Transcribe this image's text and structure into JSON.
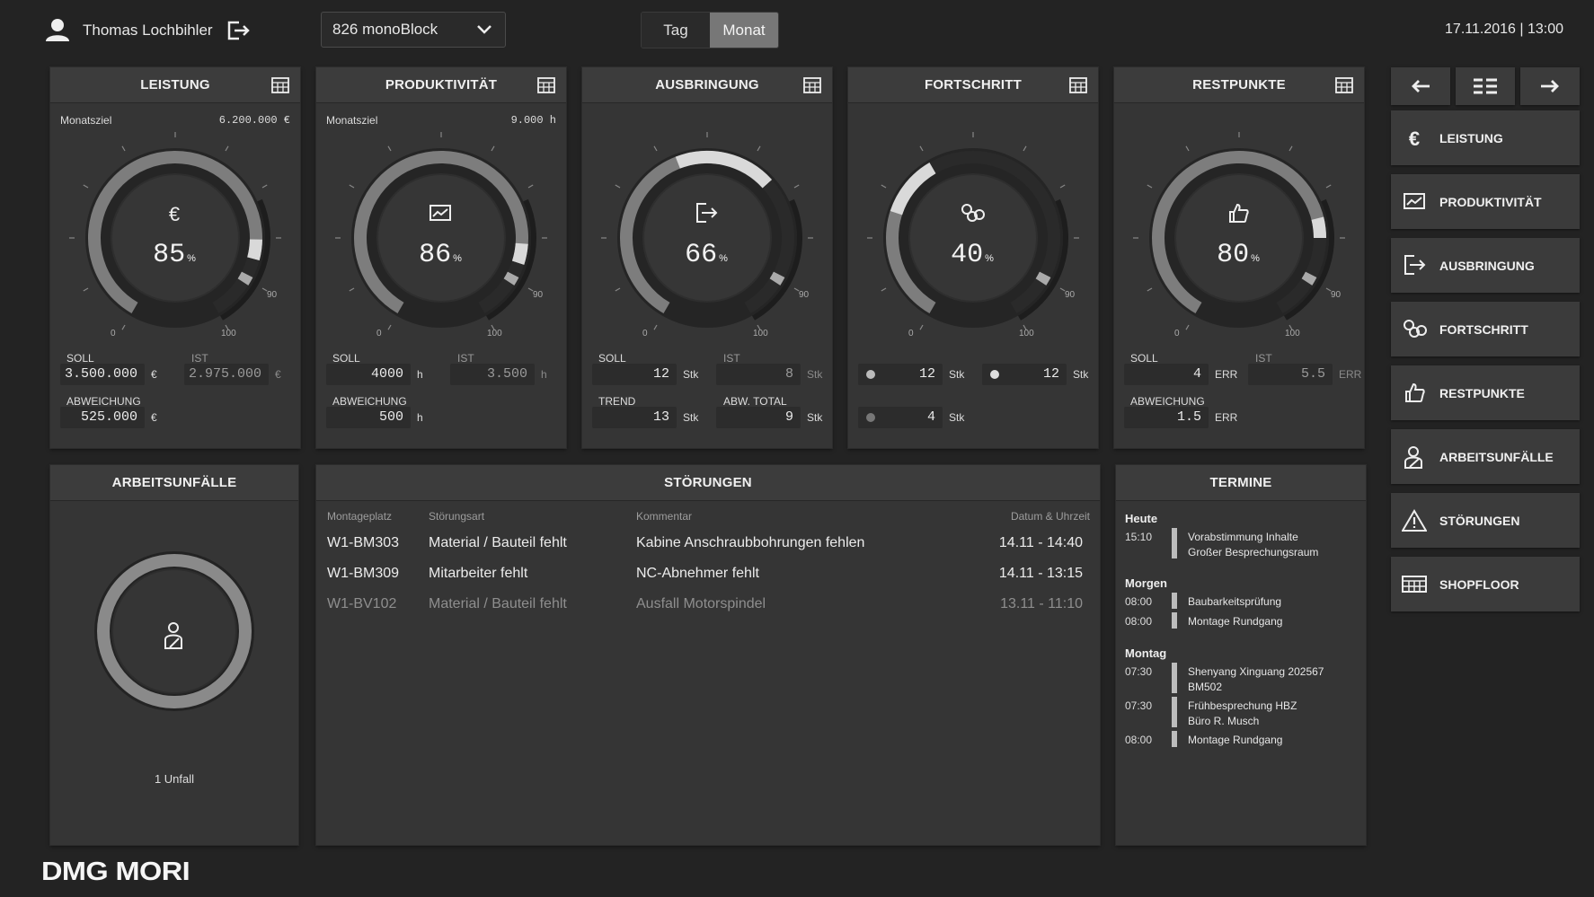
{
  "header": {
    "username": "Thomas Lochbihler",
    "machine": "826 monoBlock",
    "period_options": [
      "Tag",
      "Monat"
    ],
    "period_active": "Monat",
    "datetime": "17.11.2016 | 13:00"
  },
  "kpi": [
    {
      "title": "LEISTUNG",
      "goal_label": "Monatsziel",
      "goal_value": "6.200.000 €",
      "icon": "euro-icon",
      "percent": "85",
      "percent_unit": "%",
      "percent_value": 85,
      "tick_0": "0",
      "tick_90": "90",
      "tick_100": "100",
      "soll_label": "SOLL",
      "soll": "3.500.000",
      "soll_unit": "€",
      "ist_label": "IST",
      "ist": "2.975.000",
      "ist_unit": "€",
      "abw_label": "ABWEICHUNG",
      "abw": "525.000",
      "abw_unit": "€"
    },
    {
      "title": "PRODUKTIVITÄT",
      "goal_label": "Monatsziel",
      "goal_value": "9.000 h",
      "icon": "chart-icon",
      "percent": "86",
      "percent_unit": "%",
      "percent_value": 86,
      "tick_0": "0",
      "tick_90": "90",
      "tick_100": "100",
      "soll_label": "SOLL",
      "soll": "4000",
      "soll_unit": "h",
      "ist_label": "IST",
      "ist": "3.500",
      "ist_unit": "h",
      "abw_label": "ABWEICHUNG",
      "abw": "500",
      "abw_unit": "h"
    },
    {
      "title": "AUSBRINGUNG",
      "icon": "output-icon",
      "percent": "66",
      "percent_unit": "%",
      "percent_value": 66,
      "tick_0": "0",
      "tick_90": "90",
      "tick_100": "100",
      "soll_label": "SOLL",
      "soll": "12",
      "soll_unit": "Stk",
      "ist_label": "IST",
      "ist": "8",
      "ist_unit": "Stk",
      "abw_label": "TREND",
      "abw": "13",
      "abw_unit": "Stk",
      "total_label": "ABW. TOTAL",
      "total": "9",
      "total_unit": "Stk"
    },
    {
      "title": "FORTSCHRITT",
      "icon": "progress-icon",
      "percent": "40",
      "percent_unit": "%",
      "percent_value": 40,
      "tick_0": "0",
      "tick_90": "90",
      "tick_100": "100",
      "soll": "12",
      "soll_unit": "Stk",
      "ist": "12",
      "ist_unit": "Stk",
      "abw": "4",
      "abw_unit": "Stk"
    },
    {
      "title": "RESTPUNKTE",
      "icon": "thumb-icon",
      "percent": "80",
      "percent_unit": "%",
      "percent_value": 80,
      "tick_0": "0",
      "tick_90": "90",
      "tick_100": "100",
      "soll_label": "SOLL",
      "soll": "4",
      "soll_unit": "ERR",
      "ist_label": "IST",
      "ist": "5.5",
      "ist_unit": "ERR",
      "abw_label": "ABWEICHUNG",
      "abw": "1.5",
      "abw_unit": "ERR"
    }
  ],
  "accidents": {
    "title": "ARBEITSUNFÄLLE",
    "count_text": "1 Unfall"
  },
  "faults": {
    "title": "STÖRUNGEN",
    "columns": [
      "Montageplatz",
      "Störungsart",
      "Kommentar",
      "Datum & Uhrzeit"
    ],
    "rows": [
      [
        "W1-BM303",
        "Material / Bauteil fehlt",
        "Kabine Anschraubbohrungen fehlen",
        "14.11 - 14:40"
      ],
      [
        "W1-BM309",
        "Mitarbeiter fehlt",
        "NC-Abnehmer fehlt",
        "14.11 - 13:15"
      ],
      [
        "W1-BV102",
        "Material / Bauteil fehlt",
        "Ausfall Motorspindel",
        "13.11 - 11:10"
      ]
    ]
  },
  "schedule": {
    "title": "TERMINE",
    "day1": "Heute",
    "day2": "Morgen",
    "day3": "Montag",
    "items": [
      {
        "time": "15:10",
        "text": "Vorabstimmung Inhalte",
        "text2": "Großer Besprechungsraum"
      },
      {
        "time": "08:00",
        "text": "Baubarkeitsprüfung"
      },
      {
        "time": "08:00",
        "text": "Montage Rundgang"
      },
      {
        "time": "07:30",
        "text": "Shenyang Xinguang 202567",
        "text2": "BM502"
      },
      {
        "time": "07:30",
        "text": "Frühbesprechung HBZ",
        "text2": "Büro R. Musch"
      },
      {
        "time": "08:00",
        "text": "Montage Rundgang"
      }
    ]
  },
  "sidebar": {
    "items": [
      "LEISTUNG",
      "PRODUKTIVITÄT",
      "AUSBRINGUNG",
      "FORTSCHRITT",
      "RESTPUNKTE",
      "ARBEITSUNFÄLLE",
      "STÖRUNGEN",
      "SHOPFLOOR"
    ]
  },
  "logo": "DMG MORI"
}
